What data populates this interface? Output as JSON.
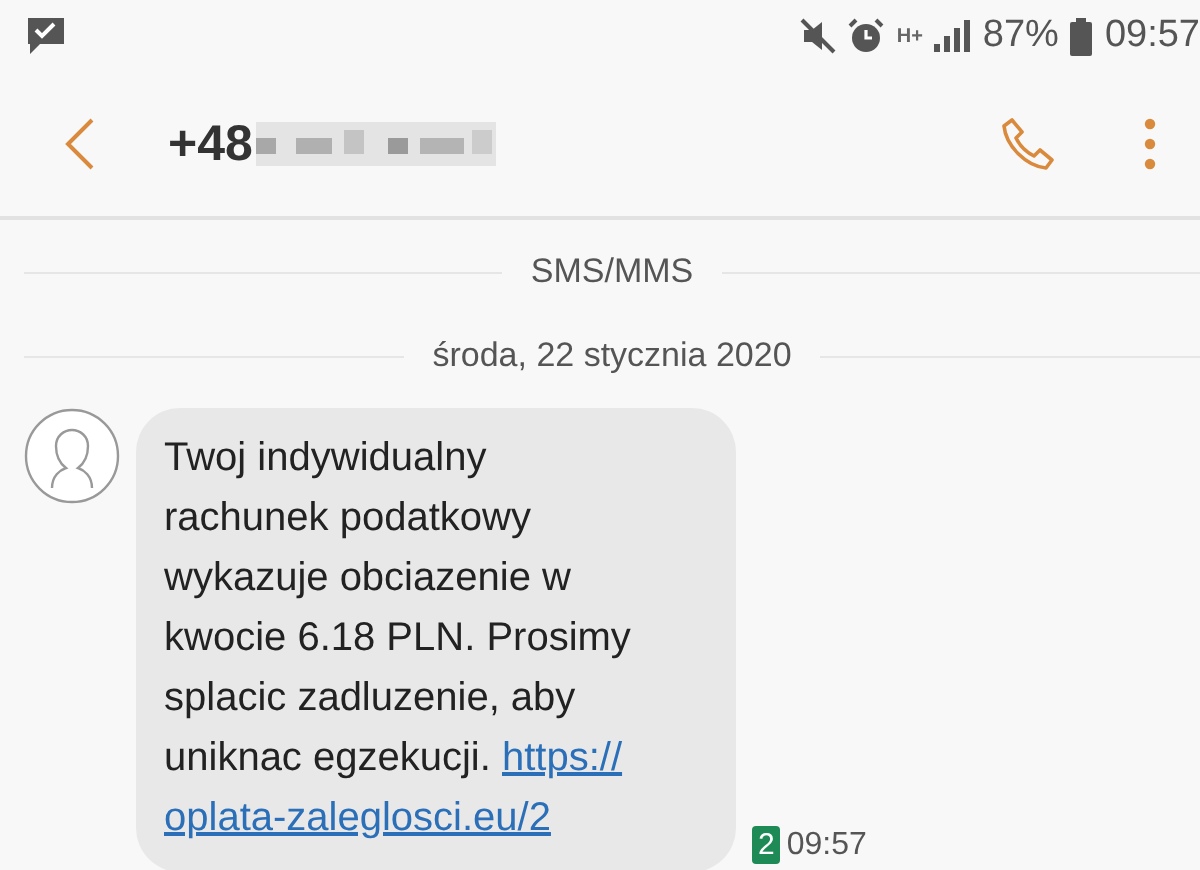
{
  "status_bar": {
    "battery": "87%",
    "time": "09:57",
    "network": "H+"
  },
  "header": {
    "number_prefix": "+48"
  },
  "section_label": "SMS/MMS",
  "date_label": "środa, 22 stycznia 2020",
  "message": {
    "lines": [
      "Twoj indywidualny",
      "rachunek podatkowy",
      "wykazuje obciazenie w",
      "kwocie 6.18 PLN. Prosimy",
      "splacic zadluzenie, aby",
      "uniknac egzekucji."
    ],
    "link_parts": [
      "https://",
      "oplata-zaleglosci.eu/2"
    ],
    "sim": "2",
    "time": "09:57"
  }
}
